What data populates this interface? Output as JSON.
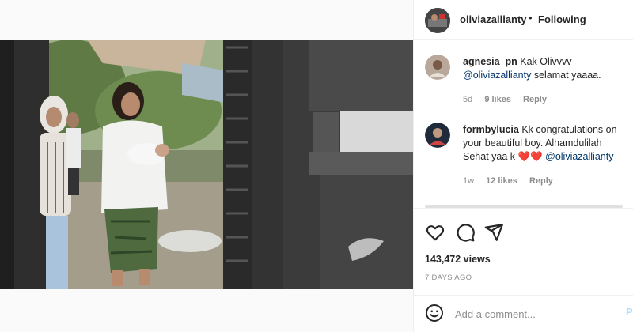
{
  "post_header": {
    "username": "oliviazallianty",
    "separator": "•",
    "follow_status": "Following"
  },
  "comments": [
    {
      "username": "agnesia_pn",
      "text_before": "Kak Olivvvv",
      "mention": "@oliviazallianty",
      "text_after": "selamat yaaaa.",
      "age": "5d",
      "likes": "9 likes",
      "reply": "Reply"
    },
    {
      "username": "formbylucia",
      "text_before": "Kk congratulations on your beautiful boy. Alhamdulilah Sehat yaa k",
      "hearts": "❤️❤️",
      "mention": "@oliviazallianty",
      "age": "1w",
      "likes": "12 likes",
      "reply": "Reply"
    }
  ],
  "actions": {
    "like_icon": "heart-outline-icon",
    "comment_icon": "comment-bubble-icon",
    "share_icon": "paper-plane-icon"
  },
  "stats": {
    "views": "143,472 views",
    "date": "7 DAYS AGO"
  },
  "add_comment": {
    "placeholder": "Add a comment...",
    "emoji_icon": "smiley-icon",
    "post_label": "P"
  },
  "colors": {
    "mention": "#00376b",
    "meta": "#8e8e8e",
    "border": "#efefef",
    "heart": "#ed4956"
  }
}
